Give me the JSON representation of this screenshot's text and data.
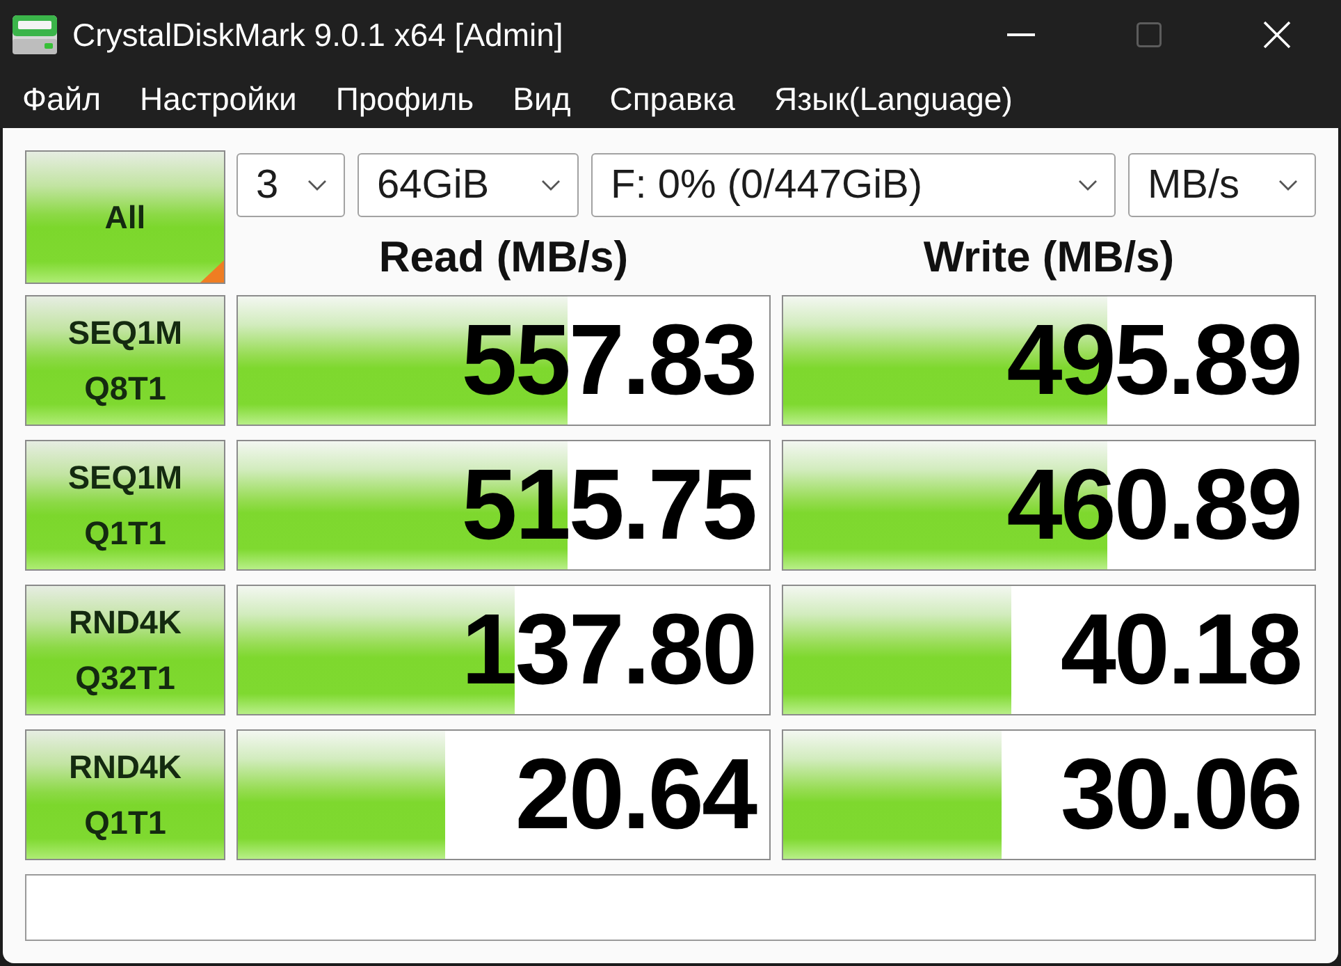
{
  "window": {
    "title": "CrystalDiskMark 9.0.1 x64 [Admin]",
    "controls": [
      {
        "kind": "minimize",
        "disabled": false
      },
      {
        "kind": "maximize",
        "disabled": true
      },
      {
        "kind": "close",
        "disabled": false
      }
    ]
  },
  "menu": [
    "Файл",
    "Настройки",
    "Профиль",
    "Вид",
    "Справка",
    "Язык(Language)"
  ],
  "toolbar": {
    "all_button": "All",
    "dropdowns": [
      "3",
      "64GiB",
      "F: 0% (0/447GiB)",
      "MB/s"
    ]
  },
  "columns": [
    "Read (MB/s)",
    "Write (MB/s)"
  ],
  "tests": [
    {
      "label_lines": [
        "SEQ1M",
        "Q8T1"
      ],
      "read": {
        "value": "557.83",
        "level": 0.62
      },
      "write": {
        "value": "495.89",
        "level": 0.61
      }
    },
    {
      "label_lines": [
        "SEQ1M",
        "Q1T1"
      ],
      "read": {
        "value": "515.75",
        "level": 0.62
      },
      "write": {
        "value": "460.89",
        "level": 0.61
      }
    },
    {
      "label_lines": [
        "RND4K",
        "Q32T1"
      ],
      "read": {
        "value": "137.80",
        "level": 0.52
      },
      "write": {
        "value": "40.18",
        "level": 0.43
      }
    },
    {
      "label_lines": [
        "RND4K",
        "Q1T1"
      ],
      "read": {
        "value": "20.64",
        "level": 0.39
      },
      "write": {
        "value": "30.06",
        "level": 0.41
      }
    }
  ]
}
